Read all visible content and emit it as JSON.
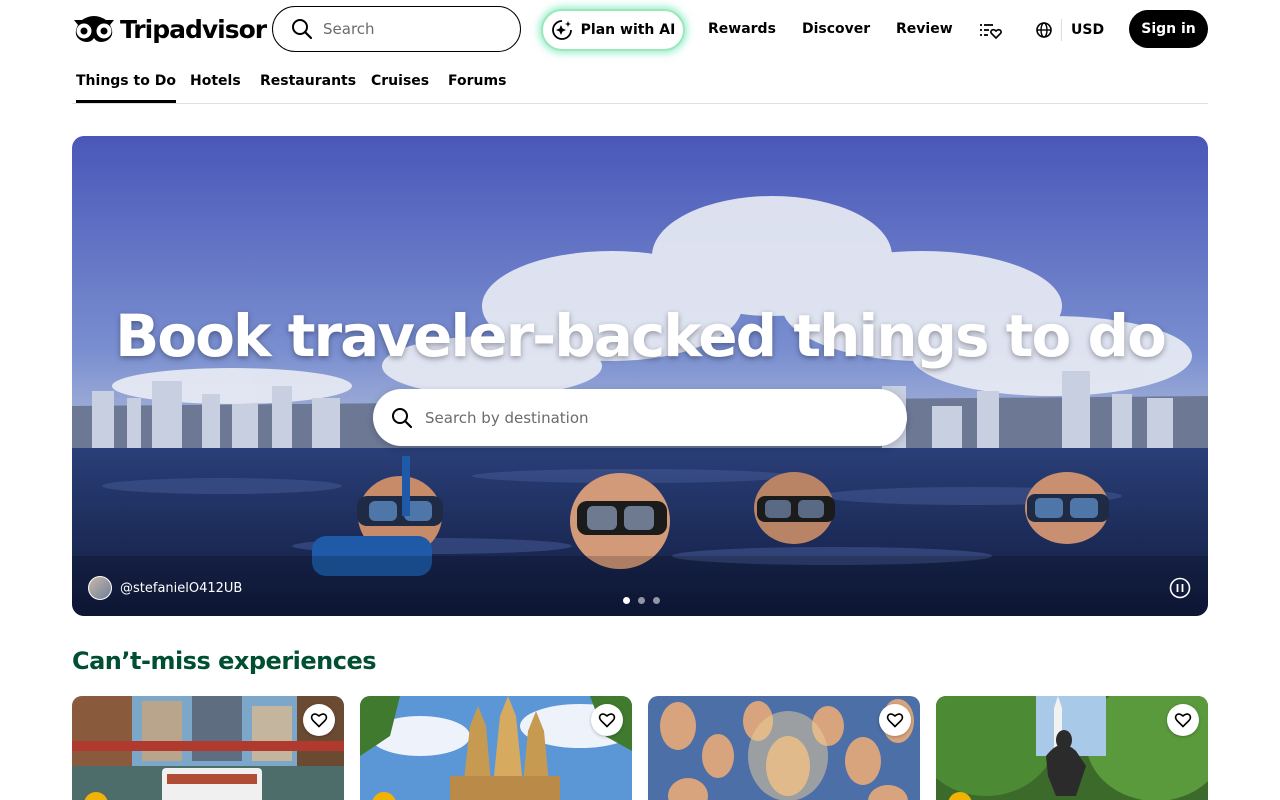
{
  "header": {
    "brand": "Tripadvisor",
    "search_placeholder": "Search",
    "plan_ai_label": "Plan with AI",
    "nav": [
      "Rewards",
      "Discover",
      "Review"
    ],
    "currency": "USD",
    "signin_label": "Sign in"
  },
  "subnav": {
    "tabs": [
      {
        "label": "Things to Do",
        "active": true
      },
      {
        "label": "Hotels",
        "active": false
      },
      {
        "label": "Restaurants",
        "active": false
      },
      {
        "label": "Cruises",
        "active": false
      },
      {
        "label": "Forums",
        "active": false
      }
    ]
  },
  "hero": {
    "title": "Book traveler-backed things to do",
    "search_placeholder": "Search by destination",
    "photo_credit": "@stefanielO412UB",
    "slide_count": 3,
    "active_slide": 1
  },
  "section": {
    "title": "Can’t-miss experiences",
    "cards": [
      {
        "image": "chicago-river-boat-tour",
        "has_badge": true
      },
      {
        "image": "sagrada-familia",
        "has_badge": true
      },
      {
        "image": "sistine-chapel-fresco",
        "has_badge": false
      },
      {
        "image": "paul-revere-statue-boston",
        "has_badge": true
      }
    ]
  },
  "colors": {
    "brand_green": "#004f32",
    "black": "#000000",
    "ai_glow": "#34e0a1",
    "badge_yellow": "#f2b203"
  },
  "icons": [
    "owl-logo-icon",
    "search-icon",
    "ai-sparkle-icon",
    "trips-heart-list-icon",
    "globe-icon",
    "pause-icon",
    "heart-icon"
  ]
}
